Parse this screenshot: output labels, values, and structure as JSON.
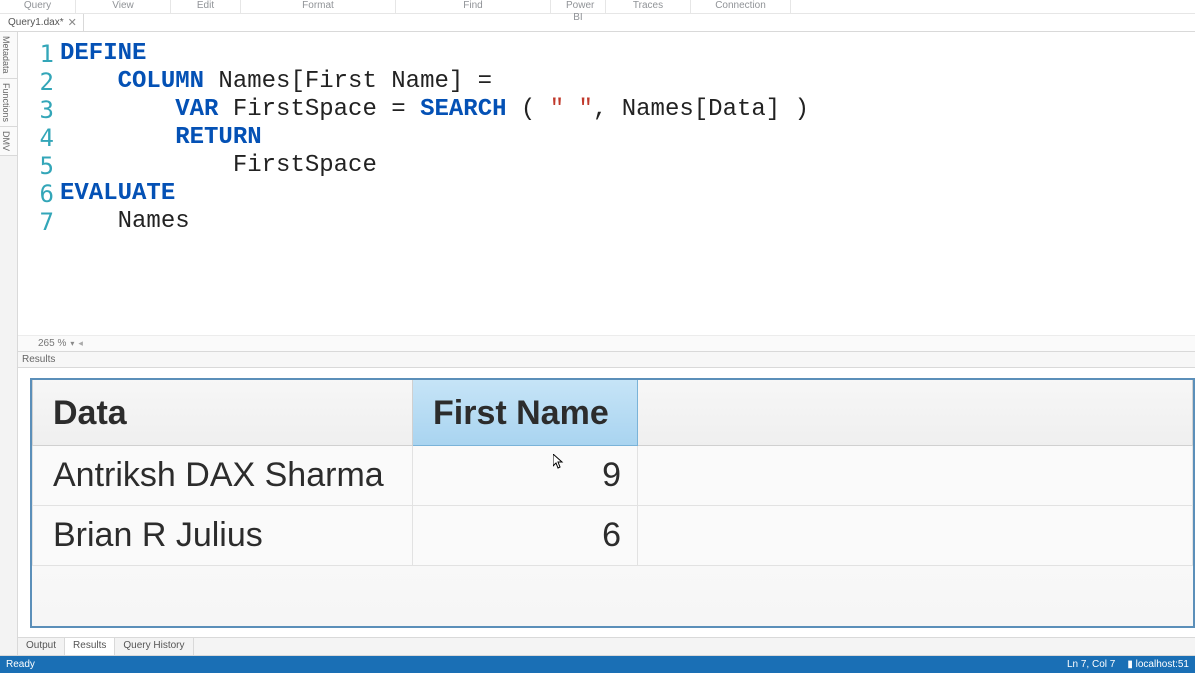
{
  "menu": {
    "items": [
      "Query",
      "View",
      "Edit",
      "Format",
      "Find",
      "Power BI",
      "Traces",
      "Connection"
    ]
  },
  "tab": {
    "label": "Query1.dax*",
    "close": "✕"
  },
  "leftbar": {
    "items": [
      "Metadata",
      "Functions",
      "DMV"
    ]
  },
  "editor": {
    "gutter": [
      "1",
      "2",
      "3",
      "4",
      "5",
      "6",
      "7"
    ],
    "code": {
      "l1": {
        "kw": "DEFINE"
      },
      "l2": {
        "indent": "    ",
        "kw": "COLUMN",
        "rest": " Names[First Name] ="
      },
      "l3": {
        "indent": "        ",
        "kw": "VAR",
        "txt1": " FirstSpace = ",
        "fn": "SEARCH",
        "br1": " ( ",
        "str": "\" \"",
        "comma": ", ",
        "arg": "Names[Data]",
        "br2": " )"
      },
      "l4": {
        "indent": "        ",
        "kw": "RETURN"
      },
      "l5": {
        "indent": "            ",
        "txt": "FirstSpace"
      },
      "l6": {
        "kw": "EVALUATE"
      },
      "l7": {
        "indent": "    ",
        "txt": "Names"
      }
    },
    "zoom": "265 %"
  },
  "results": {
    "panel_label": "Results",
    "headers": [
      "Data",
      "First Name"
    ],
    "rows": [
      {
        "data": "Antriksh DAX Sharma",
        "first_name": "9"
      },
      {
        "data": "Brian R Julius",
        "first_name": "6"
      }
    ],
    "tabs": [
      "Output",
      "Results",
      "Query History"
    ]
  },
  "status": {
    "left": "Ready",
    "loc": "Ln 7, Col 7",
    "conn": "localhost:51"
  },
  "chart_data": {
    "type": "table",
    "title": "Names",
    "columns": [
      "Data",
      "First Name"
    ],
    "rows": [
      [
        "Antriksh DAX Sharma",
        9
      ],
      [
        "Brian R Julius",
        6
      ]
    ]
  }
}
